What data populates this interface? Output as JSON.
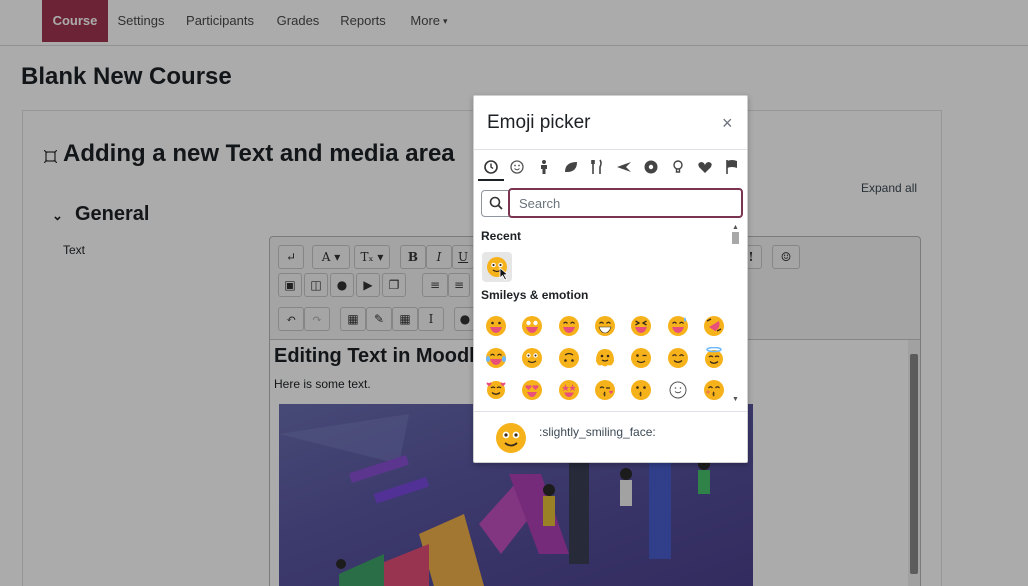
{
  "nav": {
    "tabs": [
      {
        "label": "Course",
        "active": true
      },
      {
        "label": "Settings"
      },
      {
        "label": "Participants"
      },
      {
        "label": "Grades"
      },
      {
        "label": "Reports"
      },
      {
        "label": "More"
      }
    ]
  },
  "page": {
    "course_title": "Blank New Course",
    "section_heading": "Adding a new Text and media area",
    "expand_all": "Expand all",
    "general_heading": "General",
    "text_label": "Text"
  },
  "editor": {
    "heading": "Editing Text in Moodle",
    "body_text": "Here is some text.",
    "toolbar": {
      "row1": [
        "↵",
        "A ▾",
        "Tₓ ▾",
        "B",
        "I",
        "U"
      ],
      "row2_icons": [
        "image-icon",
        "media-icon",
        "record-audio-icon",
        "record-video-icon",
        "manage-files-icon",
        "align-left-icon",
        "align-center-icon"
      ],
      "row3_icons": [
        "undo-icon",
        "redo-icon",
        "equation-icon",
        "edit-icon",
        "table-icon",
        "cursor-icon"
      ]
    }
  },
  "picker": {
    "title": "Emoji picker",
    "close_label": "×",
    "categories": [
      "recent",
      "smileys",
      "people",
      "nature",
      "food",
      "travel",
      "activities",
      "objects",
      "symbols",
      "flags"
    ],
    "search_placeholder": "Search",
    "recent_label": "Recent",
    "smileys_label": "Smileys & emotion",
    "preview_name": ":slightly_smiling_face:"
  },
  "colors": {
    "active_tab": "#a1354f",
    "search_focus": "#7a3450",
    "emoji_yellow": "#f6b21a",
    "emoji_pink": "#e8507a"
  }
}
